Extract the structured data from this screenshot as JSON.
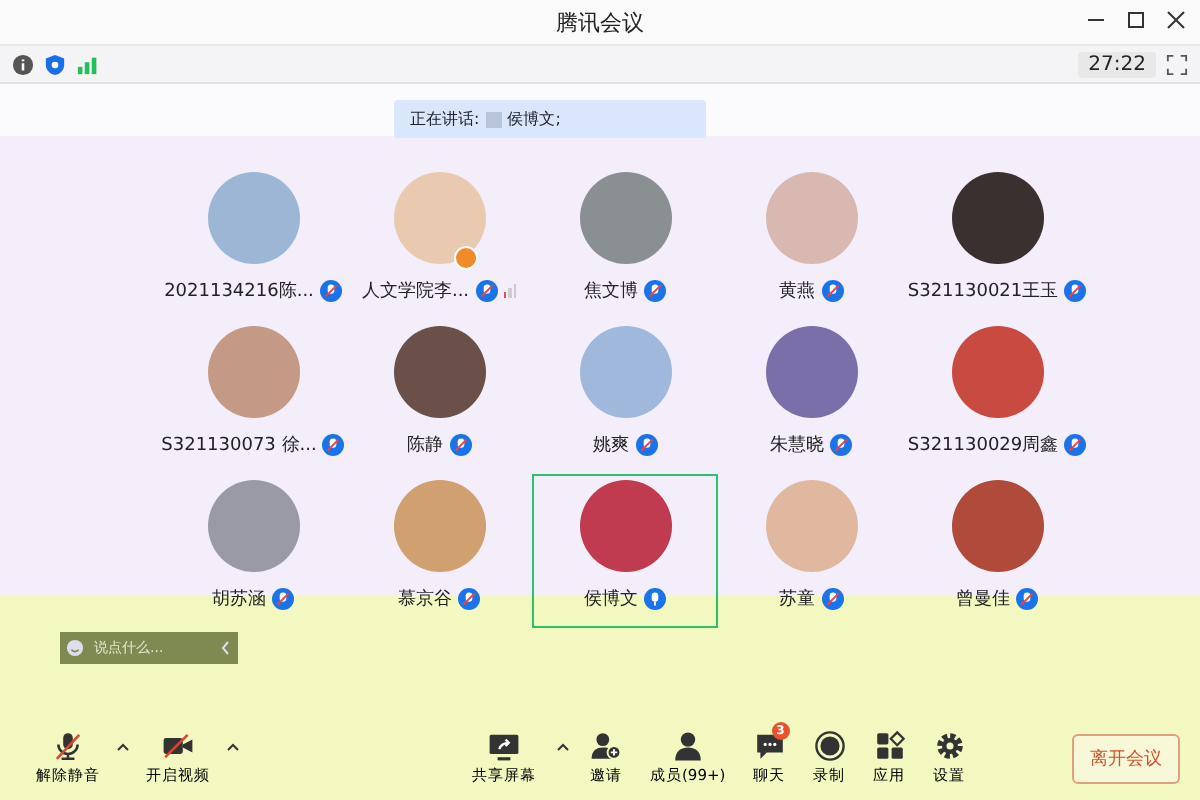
{
  "window": {
    "title": "腾讯会议"
  },
  "info_bar": {
    "timer": "27:22"
  },
  "speaking_banner": {
    "label": "正在讲话:",
    "names": "侯博文;"
  },
  "participants": [
    {
      "name": "2021134216陈...",
      "host": false,
      "speaking": false,
      "weak_signal": false
    },
    {
      "name": "人文学院李...",
      "host": true,
      "speaking": false,
      "weak_signal": true
    },
    {
      "name": "焦文博",
      "host": false,
      "speaking": false,
      "weak_signal": false
    },
    {
      "name": "黄燕",
      "host": false,
      "speaking": false,
      "weak_signal": false
    },
    {
      "name": "S321130021王玉",
      "host": false,
      "speaking": false,
      "weak_signal": false
    },
    {
      "name": "S321130073 徐...",
      "host": false,
      "speaking": false,
      "weak_signal": false
    },
    {
      "name": "陈静",
      "host": false,
      "speaking": false,
      "weak_signal": false
    },
    {
      "name": "姚爽",
      "host": false,
      "speaking": false,
      "weak_signal": false
    },
    {
      "name": "朱慧晓",
      "host": false,
      "speaking": false,
      "weak_signal": false
    },
    {
      "name": "S321130029周鑫",
      "host": false,
      "speaking": false,
      "weak_signal": false
    },
    {
      "name": "胡苏涵",
      "host": false,
      "speaking": false,
      "weak_signal": false
    },
    {
      "name": "慕京谷",
      "host": false,
      "speaking": false,
      "weak_signal": false
    },
    {
      "name": "侯博文",
      "host": false,
      "speaking": true,
      "weak_signal": false
    },
    {
      "name": "苏童",
      "host": false,
      "speaking": false,
      "weak_signal": false
    },
    {
      "name": "曾曼佳",
      "host": false,
      "speaking": false,
      "weak_signal": false
    }
  ],
  "chat_input": {
    "placeholder": "说点什么..."
  },
  "toolbar": {
    "left": [
      {
        "kind": "mic",
        "label": "解除静音",
        "caret": true
      },
      {
        "kind": "camera",
        "label": "开启视频",
        "caret": true
      }
    ],
    "center": [
      {
        "kind": "share",
        "label": "共享屏幕",
        "caret": true
      },
      {
        "kind": "invite",
        "label": "邀请",
        "caret": false
      },
      {
        "kind": "members",
        "label": "成员(99+)",
        "caret": false
      },
      {
        "kind": "chat",
        "label": "聊天",
        "caret": false,
        "badge": "3"
      },
      {
        "kind": "record",
        "label": "录制",
        "caret": false
      },
      {
        "kind": "apps",
        "label": "应用",
        "caret": false
      },
      {
        "kind": "settings",
        "label": "设置",
        "caret": false
      }
    ],
    "leave_button": "离开会议"
  }
}
